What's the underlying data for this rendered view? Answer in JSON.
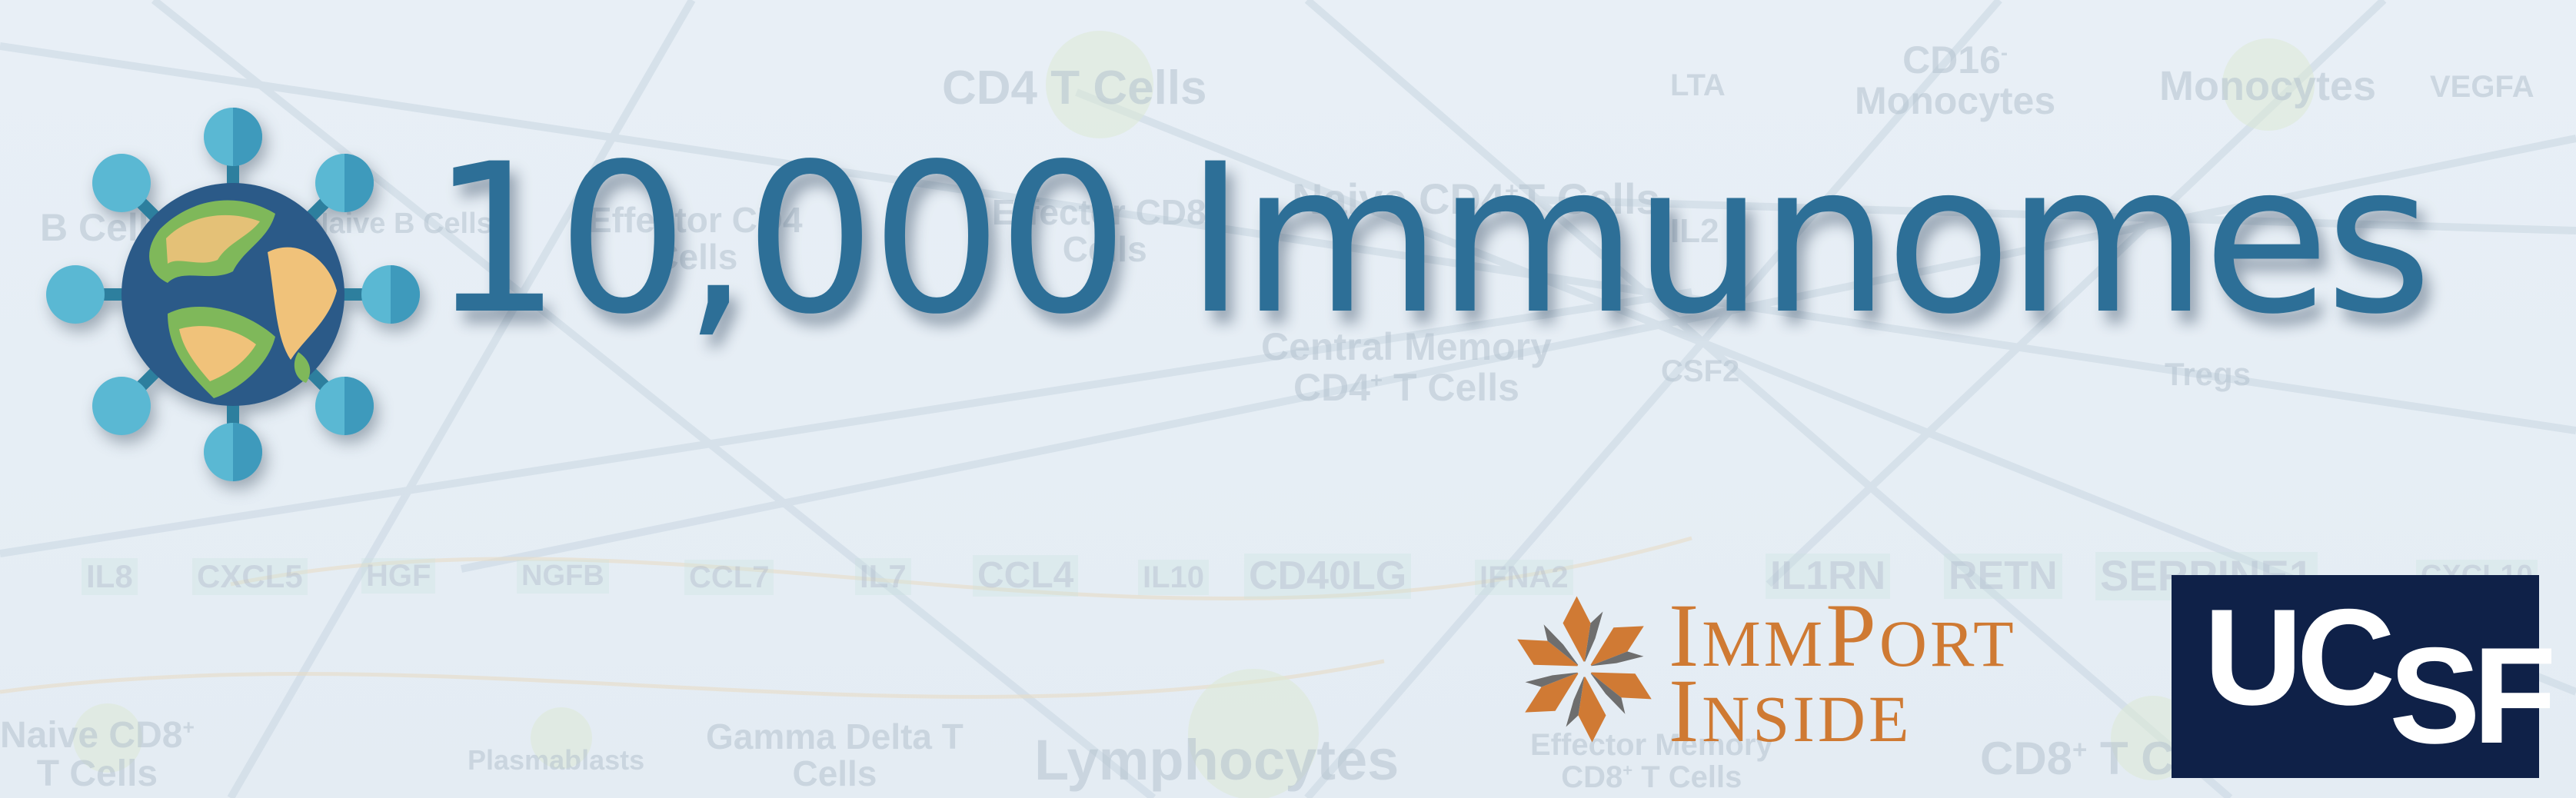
{
  "title": "10,000 Immunomes",
  "logos": {
    "project_icon": "globe-virus-icon",
    "immport_line1_big": "I",
    "immport_line1_rest": "MM",
    "immport_line1_big2": "P",
    "immport_line1_rest2": "ORT",
    "immport_line2_big": "I",
    "immport_line2_rest": "NSIDE",
    "ucsf_part1": "UC",
    "ucsf_part2": "SF"
  },
  "background_labels": {
    "cd4_t_cells": "CD4 T Cells",
    "lta": "LTA",
    "cd16_monocytes_1": "CD16",
    "cd16_monocytes_sup": "-",
    "cd16_monocytes_2": "Monocytes",
    "monocytes": "Monocytes",
    "vegfa": "VEGFA",
    "b_cells": "B Cells",
    "naive_b_cells": "Naive B Cells",
    "effector_cd4_1": "Effector CD4",
    "effector_cd4_2": "Cells",
    "effector_cd8_1": "Effector CD8",
    "effector_cd8_sup": "+",
    "effector_cd8_2": "Cells",
    "naive_cd4_1": "Naive CD4",
    "naive_cd4_sup": "+",
    "naive_cd4_2": "T Cells",
    "il2": "IL2",
    "central_memory_1": "Central Memory",
    "central_memory_2": "CD4",
    "central_memory_sup": "+",
    "central_memory_3": " T Cells",
    "csf2": "CSF2",
    "tregs": "Tregs",
    "il8": "IL8",
    "cxcl5": "CXCL5",
    "hgf": "HGF",
    "ngfb": "NGFB",
    "ccl7": "CCL7",
    "il7": "IL7",
    "ccl4": "CCL4",
    "il10": "IL10",
    "cd40lg": "CD40LG",
    "ifna2": "IFNA2",
    "il1rn": "IL1RN",
    "retn": "RETN",
    "serpine1": "SERPINE1",
    "cxcl10": "CXCL10",
    "naive_cd8_1": "Naive CD8",
    "naive_cd8_sup": "+",
    "naive_cd8_2": "T Cells",
    "plasmablasts": "Plasmablasts",
    "gamma_delta_1": "Gamma Delta T",
    "gamma_delta_2": "Cells",
    "lymphocytes": "Lymphocytes",
    "effector_memory_1": "Effector Memory",
    "effector_memory_2": "CD8",
    "effector_memory_sup": "+",
    "effector_memory_3": " T Cells",
    "cd8_t_cells": "CD8",
    "cd8_t_cells_sup": "+",
    "cd8_t_cells_2": " T C"
  },
  "colors": {
    "title": "#2d6f97",
    "background": "#e8eff6",
    "immport_orange": "#cf7a33",
    "ucsf_navy": "#0f2148",
    "globe_ocean": "#2b5a88",
    "globe_land_green": "#7fb85a",
    "globe_land_sand": "#f0c27a",
    "virus_spikes": "#4da3c2"
  }
}
